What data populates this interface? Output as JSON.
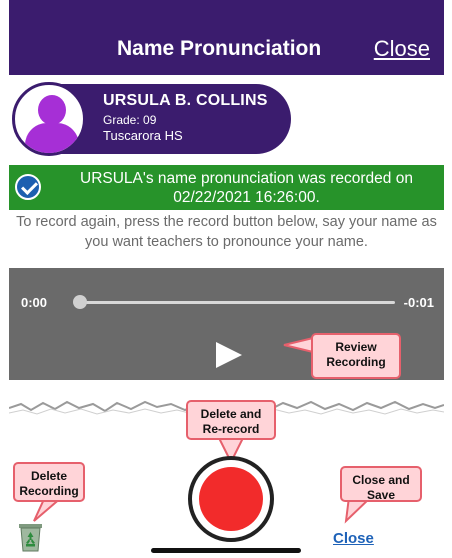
{
  "header": {
    "title": "Name Pronunciation",
    "close_label": "Close"
  },
  "student": {
    "name": "URSULA B. COLLINS",
    "grade": "Grade: 09",
    "school": "Tuscarora HS"
  },
  "banner": {
    "message": "URSULA's name pronunciation was recorded on 02/22/2021 16:26:00."
  },
  "instructions": "To record again, press the record button below, say your name as you want teachers to pronounce your name.",
  "player": {
    "current_time": "0:00",
    "remaining_time": "-0:01",
    "progress": 0
  },
  "callouts": {
    "review": "Review Recording",
    "delete_rerecord": "Delete and Re-record",
    "delete": "Delete Recording",
    "close_save": "Close and Save"
  },
  "footer": {
    "close_label": "Close"
  },
  "colors": {
    "header": "#3b1c6e",
    "banner": "#27932a",
    "record": "#f22b2b",
    "link": "#1e62b8",
    "callout_fill": "#ffd4d8",
    "callout_border": "#e6606c"
  }
}
